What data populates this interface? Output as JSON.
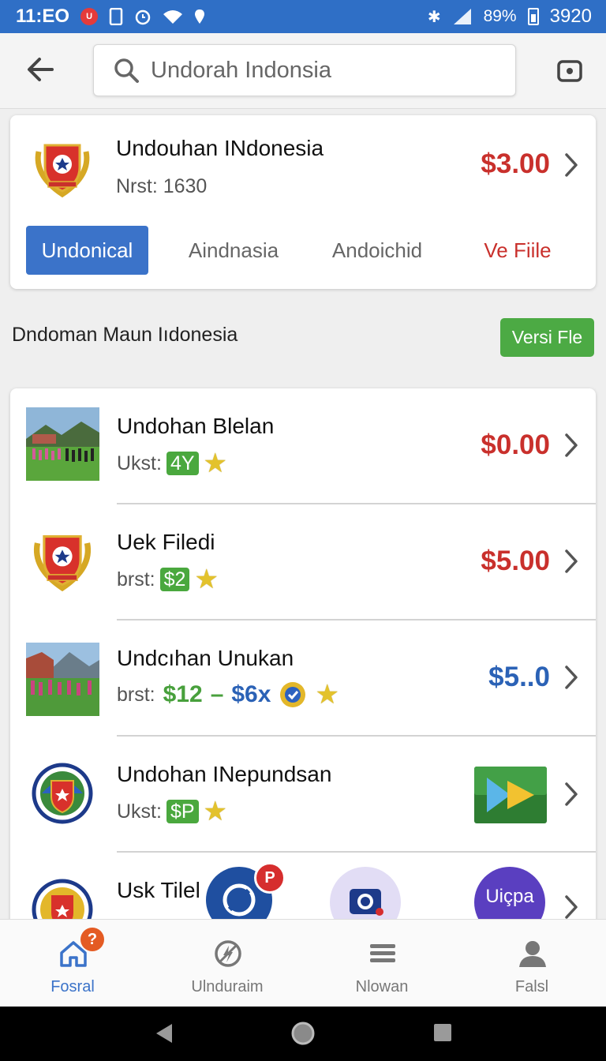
{
  "status_bar": {
    "time": "11:EO",
    "notification_badge": "U",
    "battery_pct": "89%",
    "clock_right": "3920"
  },
  "search": {
    "placeholder": "Undorah Indonsia"
  },
  "featured": {
    "title": "Undouhan INdonesia",
    "subtitle": "Nrst:  1630",
    "price": "$3.00",
    "tabs": [
      {
        "label": "Undonical",
        "active": true
      },
      {
        "label": "Aindnasia",
        "active": false
      },
      {
        "label": "Andoichid",
        "active": false
      },
      {
        "label": "Ve Fiile",
        "active": false
      }
    ]
  },
  "section": {
    "title": "Dndoman Maun Iıdonesia",
    "version_button": "Versi Fle"
  },
  "list": [
    {
      "title": "Undohan Blelan",
      "meta_label": "Ukst:",
      "pill": "4Y",
      "price": "$0.00",
      "price_color": "#c9302c"
    },
    {
      "title": "Uek Filedi",
      "meta_label": "brst:",
      "pill": "$2",
      "price": "$5.00",
      "price_color": "#c9302c"
    },
    {
      "title": "Undcıhan Unukan",
      "meta_label": "brst:",
      "range_low": "$12",
      "range_dash": "–",
      "range_high": "$6x",
      "price": "$5..0",
      "price_color": "#2b62b6"
    },
    {
      "title": "Undohan INepundsan",
      "meta_label": "Ukst:",
      "pill": "$P"
    },
    {
      "title": "Usk Tilel"
    }
  ],
  "floating": {
    "badge_letter": "P",
    "brand_label": "Uiçpa"
  },
  "bottom_nav": [
    {
      "label": "Fosral",
      "badge": "?",
      "active": true,
      "icon": "home-icon"
    },
    {
      "label": "Ulnduraim",
      "active": false,
      "icon": "no-charge-icon"
    },
    {
      "label": "Nlowan",
      "active": false,
      "icon": "menu-icon"
    },
    {
      "label": "Falsl",
      "active": false,
      "icon": "person-icon"
    }
  ],
  "colors": {
    "primary": "#3b73c9",
    "price_red": "#c9302c",
    "green": "#4caa44"
  }
}
